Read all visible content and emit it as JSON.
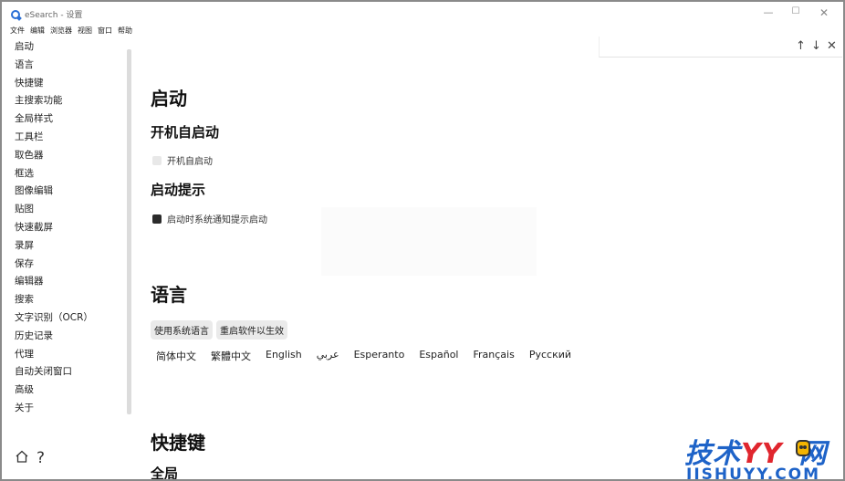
{
  "window": {
    "title": "eSearch - 设置",
    "minimize": "—",
    "maximize": "☐",
    "close": "✕"
  },
  "menu": [
    "文件",
    "编辑",
    "浏览器",
    "视图",
    "窗口",
    "帮助"
  ],
  "sidebar": {
    "items": [
      "启动",
      "语言",
      "快捷键",
      "主搜索功能",
      "全局样式",
      "工具栏",
      "取色器",
      "框选",
      "图像编辑",
      "贴图",
      "快速截屏",
      "录屏",
      "保存",
      "编辑器",
      "搜索",
      "文字识别（OCR）",
      "历史记录",
      "代理",
      "自动关闭窗口",
      "高级",
      "关于"
    ],
    "help": "?"
  },
  "find_bar": {
    "up": "↑",
    "down": "↓",
    "close": "✕"
  },
  "main": {
    "startup": {
      "heading": "启动",
      "autostart_heading": "开机自启动",
      "autostart_label": "开机自启动",
      "autostart_checked": false,
      "notify_heading": "启动提示",
      "notify_label": "启动时系统通知提示启动",
      "notify_checked": true
    },
    "language": {
      "heading": "语言",
      "use_system_button": "使用系统语言",
      "restart_button": "重启软件以生效",
      "options": [
        "简体中文",
        "繁體中文",
        "English",
        "عربي",
        "Esperanto",
        "Español",
        "Français",
        "Русский"
      ]
    },
    "shortcuts": {
      "heading": "快捷键",
      "next_heading": "全局"
    }
  },
  "watermark": {
    "cn_a": "技术",
    "cn_b": "YY",
    "cn_c": "网",
    "en": "JISHUYY.COM"
  },
  "colors": {
    "accent": "#1e63c8",
    "checkbox_on": "#2b2b2b",
    "checkbox_off": "#e8e8e8",
    "chip_bg": "#eaeaea"
  }
}
